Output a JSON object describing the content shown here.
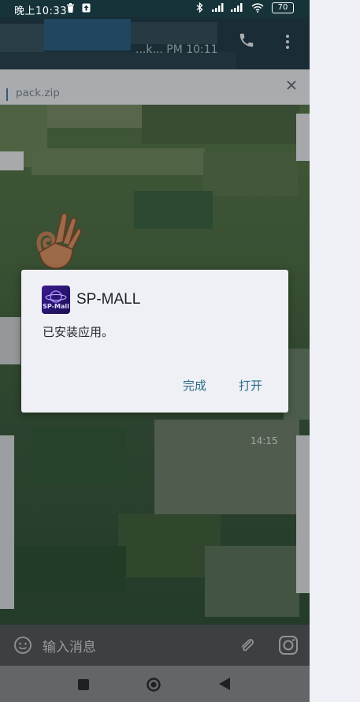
{
  "status_bar": {
    "time": "晚上10:33",
    "battery": "70"
  },
  "header": {
    "last_seen": "...k... PM 10:11"
  },
  "pinned_file": {
    "name": "pack.zip"
  },
  "dialog": {
    "app_name": "SP-MALL",
    "icon_text": "SP-Mall",
    "message": "已安装应用。",
    "done_label": "完成",
    "open_label": "打开"
  },
  "chat": {
    "time_label": "14:15"
  },
  "input_bar": {
    "placeholder": "输入消息"
  },
  "icons": {
    "status": [
      "trash-icon",
      "upload-icon",
      "bluetooth-icon",
      "signal-icon",
      "wifi-icon",
      "battery-icon"
    ],
    "header": [
      "phone-icon",
      "more-vertical-icon"
    ],
    "input": [
      "emoji-icon",
      "attach-icon",
      "instagram-icon"
    ],
    "nav": [
      "recent-apps-icon",
      "home-icon",
      "back-icon"
    ]
  },
  "colors": {
    "status_bar": "#16333a",
    "header": "#243e4a",
    "dialog_background": "#eff0f5",
    "dialog_button": "#2b6b88",
    "nav_bar": "#8a8c90"
  }
}
